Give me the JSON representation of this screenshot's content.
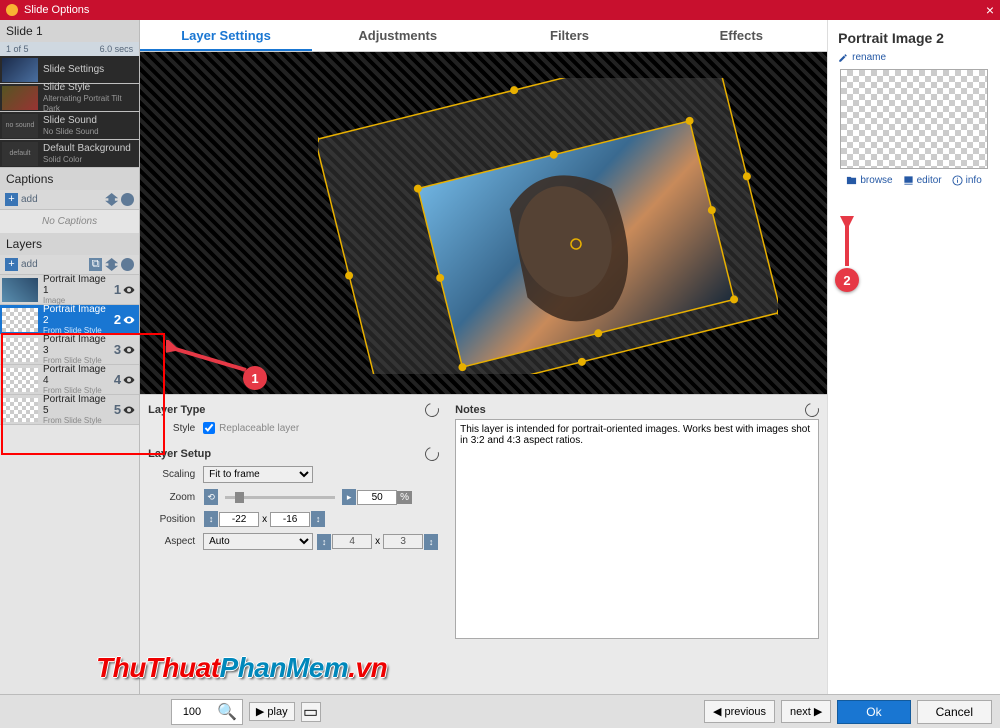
{
  "window": {
    "title": "Slide Options"
  },
  "slide": {
    "name": "Slide 1",
    "index": "1 of 5",
    "duration": "6.0 secs"
  },
  "settings": [
    {
      "title": "Slide Settings",
      "sub": ""
    },
    {
      "title": "Slide Style",
      "sub": "Alternating Portrait Tilt Dark"
    },
    {
      "title": "Slide Sound",
      "sub": "No Slide Sound",
      "tag": "no sound"
    },
    {
      "title": "Default Background",
      "sub": "Solid Color",
      "tag": "default"
    }
  ],
  "captions": {
    "label": "Captions",
    "add": "add",
    "empty": "No Captions"
  },
  "layers": {
    "label": "Layers",
    "add": "add",
    "items": [
      {
        "title": "Portrait Image 1",
        "sub": "Image",
        "num": "1",
        "img": true
      },
      {
        "title": "Portrait Image 2",
        "sub": "From Slide Style",
        "num": "2",
        "selected": true
      },
      {
        "title": "Portrait Image 3",
        "sub": "From Slide Style",
        "num": "3"
      },
      {
        "title": "Portrait Image 4",
        "sub": "From Slide Style",
        "num": "4"
      },
      {
        "title": "Portrait Image 5",
        "sub": "From Slide Style",
        "num": "5"
      }
    ]
  },
  "tabs": [
    "Layer Settings",
    "Adjustments",
    "Filters",
    "Effects"
  ],
  "layerType": {
    "head": "Layer Type",
    "styleLabel": "Style",
    "replaceable": "Replaceable layer"
  },
  "layerSetup": {
    "head": "Layer Setup",
    "scaling": {
      "label": "Scaling",
      "value": "Fit to frame"
    },
    "zoom": {
      "label": "Zoom",
      "value": "50"
    },
    "position": {
      "label": "Position",
      "x": "-22",
      "y": "-16"
    },
    "aspect": {
      "label": "Aspect",
      "value": "Auto",
      "w": "4",
      "h": "3"
    }
  },
  "notes": {
    "head": "Notes",
    "text": "This layer is intended for portrait-oriented images. Works best with images shot in 3:2 and 4:3 aspect ratios."
  },
  "rightPanel": {
    "title": "Portrait Image 2",
    "rename": "rename",
    "actions": {
      "browse": "browse",
      "editor": "editor",
      "info": "info"
    }
  },
  "footer": {
    "zoom": "100",
    "play": "play",
    "previous": "previous",
    "next": "next",
    "ok": "Ok",
    "cancel": "Cancel"
  },
  "annotations": {
    "a1": "1",
    "a2": "2"
  },
  "watermark": {
    "a": "ThuThuat",
    "b": "PhanMem",
    "c": ".vn"
  }
}
